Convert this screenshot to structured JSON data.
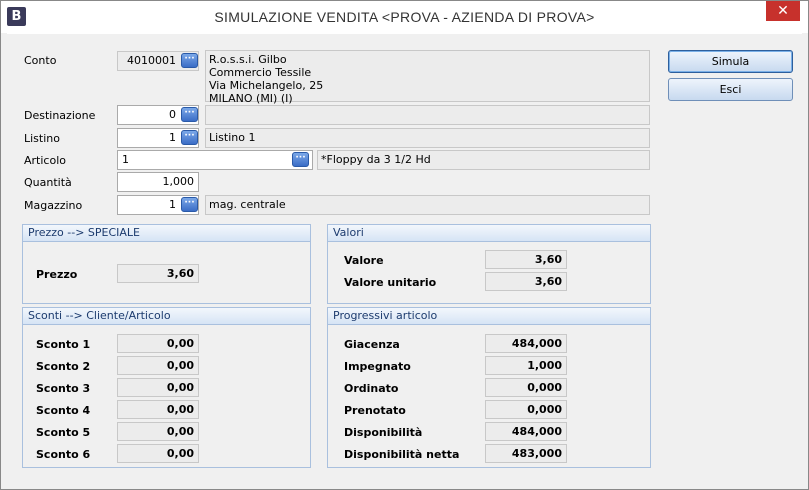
{
  "window": {
    "app_icon": "B",
    "title": "SIMULAZIONE VENDITA <PROVA - AZIENDA DI PROVA>",
    "close_glyph": "✕"
  },
  "form": {
    "conto": {
      "label": "Conto",
      "value": "4010001",
      "info": [
        "R.o.s.s.i. Gilbo",
        "Commercio Tessile",
        "Via Michelangelo, 25",
        "MILANO (MI) (I)"
      ]
    },
    "destinazione": {
      "label": "Destinazione",
      "value": "0",
      "info": ""
    },
    "listino": {
      "label": "Listino",
      "value": "1",
      "info": "Listino 1"
    },
    "articolo": {
      "label": "Articolo",
      "value": "1",
      "info": "*Floppy da 3 1/2 Hd"
    },
    "quantita": {
      "label": "Quantità",
      "value": "1,000"
    },
    "magazzino": {
      "label": "Magazzino",
      "value": "1",
      "info": "mag. centrale"
    },
    "lookup_glyph": "···"
  },
  "buttons": {
    "simula": "Simula",
    "esci": "Esci"
  },
  "prezzo_panel": {
    "title": "Prezzo --> SPECIALE",
    "label": "Prezzo",
    "value": "3,60"
  },
  "valori_panel": {
    "title": "Valori",
    "rows": [
      {
        "label": "Valore",
        "value": "3,60"
      },
      {
        "label": "Valore unitario",
        "value": "3,60"
      }
    ]
  },
  "sconti_panel": {
    "title": "Sconti --> Cliente/Articolo",
    "rows": [
      {
        "label": "Sconto 1",
        "value": "0,00"
      },
      {
        "label": "Sconto 2",
        "value": "0,00"
      },
      {
        "label": "Sconto 3",
        "value": "0,00"
      },
      {
        "label": "Sconto 4",
        "value": "0,00"
      },
      {
        "label": "Sconto 5",
        "value": "0,00"
      },
      {
        "label": "Sconto 6",
        "value": "0,00"
      }
    ]
  },
  "progressivi_panel": {
    "title": "Progressivi articolo",
    "rows": [
      {
        "label": "Giacenza",
        "value": "484,000"
      },
      {
        "label": "Impegnato",
        "value": "1,000"
      },
      {
        "label": "Ordinato",
        "value": "0,000"
      },
      {
        "label": "Prenotato",
        "value": "0,000"
      },
      {
        "label": "Disponibilità",
        "value": "484,000"
      },
      {
        "label": "Disponibilità netta",
        "value": "483,000"
      }
    ]
  }
}
